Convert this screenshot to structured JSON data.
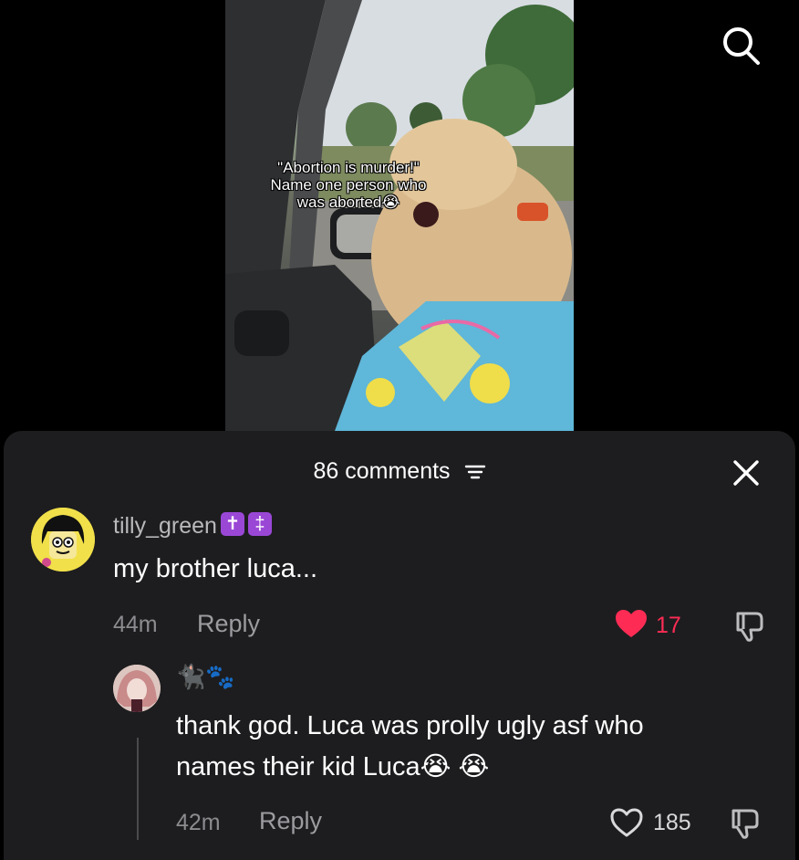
{
  "video": {
    "caption_line1": "\"Abortion is murder!\"",
    "caption_line2": "Name one person who",
    "caption_line3": "was aborted😭"
  },
  "top_bar": {
    "search_icon": "search-icon"
  },
  "comments_panel": {
    "count_label": "86 comments",
    "filter_icon": "filter-icon",
    "close_icon": "close-icon",
    "comments": [
      {
        "username": "tilly_green",
        "badges": [
          "✝",
          "‡"
        ],
        "text": "my brother luca...",
        "time": "44m",
        "reply_label": "Reply",
        "likes": "17",
        "liked": true
      }
    ],
    "replies": [
      {
        "username": "🐈‍⬛🐾",
        "text_line1": "thank god. Luca was prolly ugly asf who",
        "text_line2": "names their kid Luca😭 😭",
        "time": "42m",
        "reply_label": "Reply",
        "likes": "185",
        "liked": false
      }
    ]
  },
  "colors": {
    "sheet_bg": "#1d1d1f",
    "like_red": "#fe2c55",
    "badge_purple": "#9a47d6"
  }
}
